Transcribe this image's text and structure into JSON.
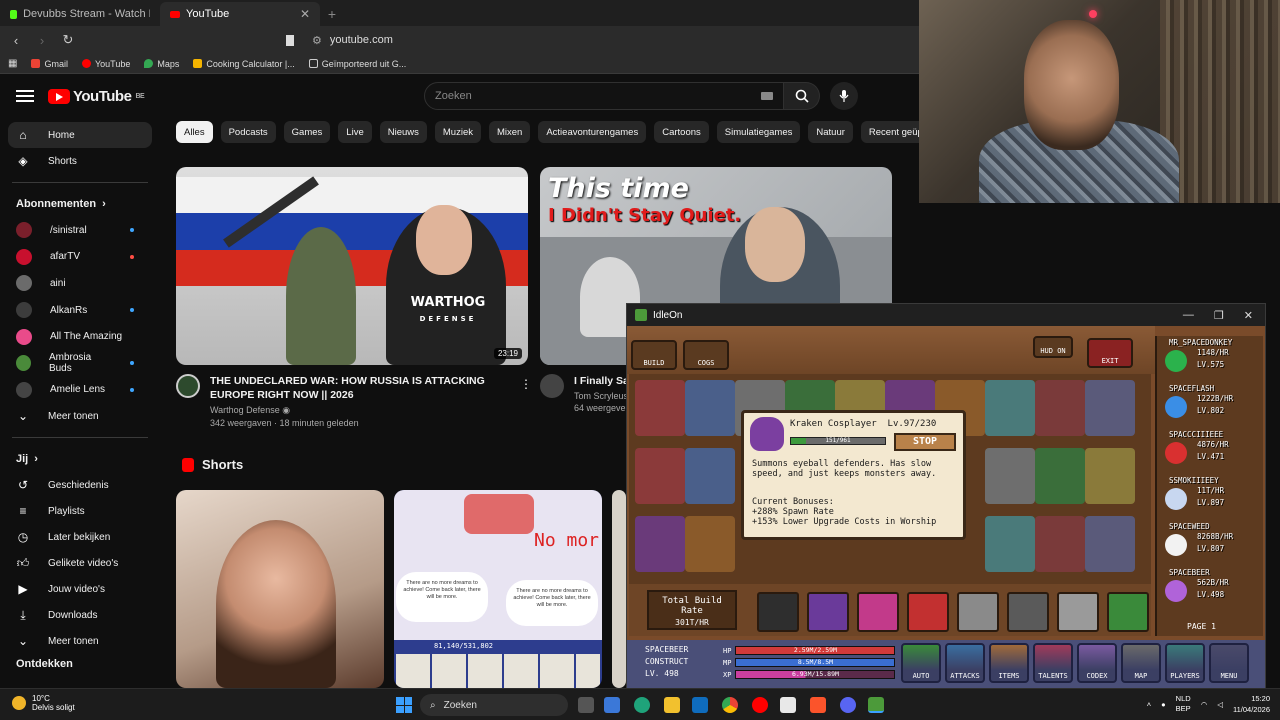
{
  "browser": {
    "tabs": [
      {
        "title": "Devubbs Stream - Watch Live on",
        "icon_color": "#53fc18",
        "active": false
      },
      {
        "title": "YouTube",
        "icon_color": "#ff0000",
        "active": true
      }
    ],
    "url": "youtube.com",
    "bookmarks": [
      {
        "label": "Gmail",
        "color": "#ea4335"
      },
      {
        "label": "YouTube",
        "color": "#ff0000"
      },
      {
        "label": "Maps",
        "color": "#34a853"
      },
      {
        "label": "Cooking Calculator |...",
        "color": "#f4b400"
      },
      {
        "label": "Geïmporteerd uit G...",
        "color": "#888888"
      }
    ]
  },
  "youtube": {
    "logo_text": "YouTube",
    "logo_region": "BE",
    "search_placeholder": "Zoeken",
    "sidebar": {
      "home": "Home",
      "shorts": "Shorts",
      "subscriptions_header": "Abonnementen",
      "subscriptions": [
        {
          "name": "/sinistral",
          "color": "#7a1f2b",
          "live": false,
          "new": true
        },
        {
          "name": "afarTV",
          "color": "#c8102e",
          "live": true,
          "new": false
        },
        {
          "name": "aini",
          "color": "#6b6b6b",
          "live": false,
          "new": false
        },
        {
          "name": "AlkanRs",
          "color": "#3c3c3c",
          "live": false,
          "new": true
        },
        {
          "name": "All The Amazing",
          "color": "#e94b8a",
          "live": false,
          "new": false
        },
        {
          "name": "Ambrosia Buds",
          "color": "#4a8a3a",
          "live": false,
          "new": true
        },
        {
          "name": "Amelie Lens",
          "color": "#444444",
          "live": false,
          "new": true
        }
      ],
      "show_more": "Meer tonen",
      "you_header": "Jij",
      "you_items": [
        "Geschiedenis",
        "Playlists",
        "Later bekijken",
        "Gelikete video's",
        "Jouw video's",
        "Downloads"
      ],
      "show_more_2": "Meer tonen",
      "explore_header": "Ontdekken"
    },
    "chips": [
      "Alles",
      "Podcasts",
      "Games",
      "Live",
      "Nieuws",
      "Muziek",
      "Mixen",
      "Actieavonturengames",
      "Cartoons",
      "Simulatiegames",
      "Natuur",
      "Recent geüp"
    ],
    "videos": [
      {
        "title": "THE UNDECLARED WAR: HOW RUSSIA IS ATTACKING EUROPE RIGHT NOW || 2026",
        "channel": "Warthog Defense",
        "meta": "342 weergaven · 18 minuten geleden",
        "duration": "23:19",
        "shirt_text": "WARTHOG",
        "shirt_sub": "DEFENSE"
      },
      {
        "title": "I Finally Sai",
        "channel": "Tom Scryleus",
        "meta": "64 weergeve",
        "overlay_title": "This time",
        "overlay_sub": "I Didn't Stay Quiet."
      }
    ],
    "shorts_header": "Shorts",
    "short_texts": {
      "no_more": "No mor",
      "cloud_left": "There are no more dreams to achieve! Come back later, there will be more.",
      "counter": "81,140/531,802"
    }
  },
  "game": {
    "window_title": "IdleOn",
    "top_buttons": [
      "BUILD",
      "COGS"
    ],
    "hud_toggle": "HUD ON",
    "exit_label": "EXIT",
    "tooltip": {
      "name": "Kraken Cosplayer",
      "level": "Lv.97/230",
      "progress_text": "151/961",
      "progress": 0.16,
      "stop_label": "STOP",
      "description": "Summons eyeball defenders. Has slow speed, and just keeps monsters away.",
      "bonuses_header": "Current Bonuses:",
      "bonus_1": "+288% Spawn Rate",
      "bonus_2": "+153% Lower Upgrade Costs in Worship"
    },
    "build_rate_label": "Total Build Rate",
    "build_rate_value": "301T/HR",
    "players": [
      {
        "name": "MR_SPACEDONKEY",
        "rate": "1148/HR",
        "level": "LV.575",
        "color": "#2bb24c"
      },
      {
        "name": "SPACEFLASH",
        "rate": "1222B/HR",
        "level": "LV.802",
        "color": "#3a8ee6"
      },
      {
        "name": "SPACCCIIIEEE",
        "rate": "4876/HR",
        "level": "LV.471",
        "color": "#d93030"
      },
      {
        "name": "SSMOKIIIEEY",
        "rate": "11T/HR",
        "level": "LV.897",
        "color": "#c8d7f0"
      },
      {
        "name": "SPACEWEED",
        "rate": "8268B/HR",
        "level": "LV.807",
        "color": "#f2f2f2"
      },
      {
        "name": "SPACEBEER",
        "rate": "562B/HR",
        "level": "LV.498",
        "color": "#b063d9"
      }
    ],
    "page_label": "PAGE 1",
    "character": {
      "name": "SPACEBEER",
      "class": "CONSTRUCT",
      "level": "LV. 498",
      "hp_label": "HP",
      "hp_text": "2.59M/2.59M",
      "mp_label": "MP",
      "mp_text": "8.5M/8.5M",
      "xp_label": "XP",
      "xp_text": "6.93M/15.89M"
    },
    "menu_buttons": [
      "AUTO",
      "ATTACKS",
      "ITEMS",
      "TALENTS",
      "CODEX",
      "MAP",
      "PLAYERS",
      "MENU"
    ]
  },
  "taskbar": {
    "temperature": "10°C",
    "weather_text": "Delvis soligt",
    "search_label": "Zoeken",
    "language_1": "NLD",
    "language_2": "BEP",
    "time": "15:20",
    "date": "11/04/2026"
  }
}
